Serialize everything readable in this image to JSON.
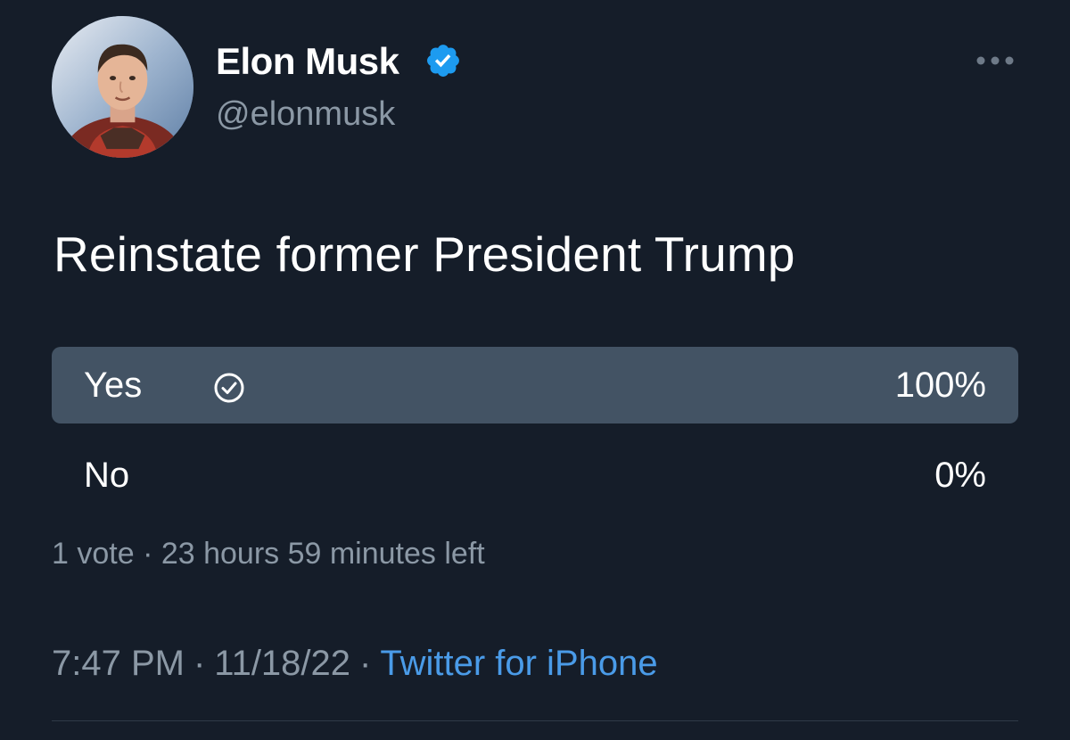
{
  "author": {
    "display_name": "Elon Musk",
    "handle": "@elonmusk",
    "verified": true
  },
  "tweet": {
    "text": "Reinstate former President Trump"
  },
  "poll": {
    "options": [
      {
        "label": "Yes",
        "percent_text": "100%",
        "share": 1.0,
        "selected": true
      },
      {
        "label": "No",
        "percent_text": "0%",
        "share": 0.0,
        "selected": false
      }
    ],
    "meta": "1 vote · 23 hours 59 minutes left"
  },
  "footer": {
    "time": "7:47 PM",
    "date": "11/18/22",
    "source": "Twitter for iPhone",
    "separator": "·"
  },
  "icons": {
    "verified": "verified-badge-icon",
    "more": "more-options-icon",
    "selected": "check-circle-icon"
  },
  "colors": {
    "background": "#151d29",
    "poll_fill": "#435364",
    "accent": "#1d9bf0",
    "link": "#4a9be8",
    "muted": "#8b98a5"
  }
}
